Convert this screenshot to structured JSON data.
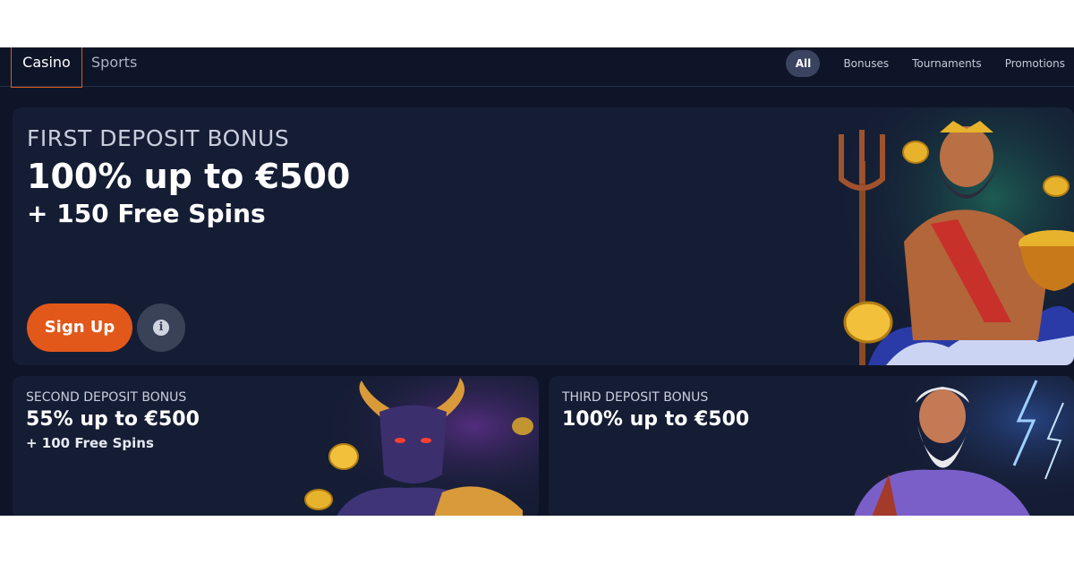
{
  "nav": {
    "tabs": [
      {
        "label": "Casino",
        "active": true
      },
      {
        "label": "Sports",
        "active": false
      }
    ],
    "filters": [
      {
        "label": "All",
        "active": true
      },
      {
        "label": "Bonuses"
      },
      {
        "label": "Tournaments"
      },
      {
        "label": "Promotions"
      }
    ]
  },
  "first_bonus": {
    "eyebrow": "FIRST DEPOSIT BONUS",
    "headline": "100% up to €500",
    "sub": "+ 150 Free Spins",
    "signup_label": "Sign Up",
    "info_glyph": "i"
  },
  "second_bonus": {
    "eyebrow": "SECOND DEPOSIT BONUS",
    "headline": "55% up to €500",
    "sub": "+ 100 Free Spins"
  },
  "third_bonus": {
    "eyebrow": "THIRD DEPOSIT BONUS",
    "headline": "100% up to €500"
  },
  "colors": {
    "background": "#0f1528",
    "card": "#151d34",
    "accent": "#e2581b",
    "gold": "#e8b32c"
  },
  "icons": [
    "info-icon",
    "poseidon-illustration",
    "minotaur-illustration",
    "zeus-illustration",
    "gold-coin-icon"
  ]
}
